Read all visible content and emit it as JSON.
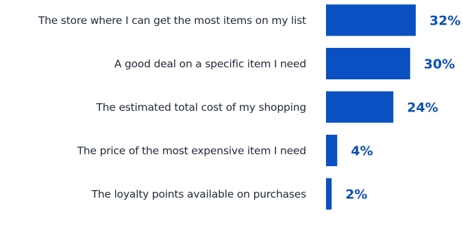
{
  "colors": {
    "bar": "#0b50c2",
    "value_text": "#0b4fb8",
    "label_text": "#1f2937",
    "background": "#ffffff"
  },
  "chart_data": {
    "type": "bar",
    "orientation": "horizontal",
    "categories": [
      "The store where I can get the most items on my list",
      "A good deal on a specific item I need",
      "The estimated total cost of my shopping",
      "The price of the most expensive item I need",
      "The loyalty points available on purchases"
    ],
    "values": [
      32,
      30,
      24,
      4,
      2
    ],
    "value_labels": [
      "32%",
      "30%",
      "24%",
      "4%",
      "2%"
    ],
    "unit": "%",
    "title": "",
    "xlabel": "",
    "ylabel": "",
    "xlim": [
      0,
      32
    ],
    "grid": false,
    "legend": "none"
  }
}
